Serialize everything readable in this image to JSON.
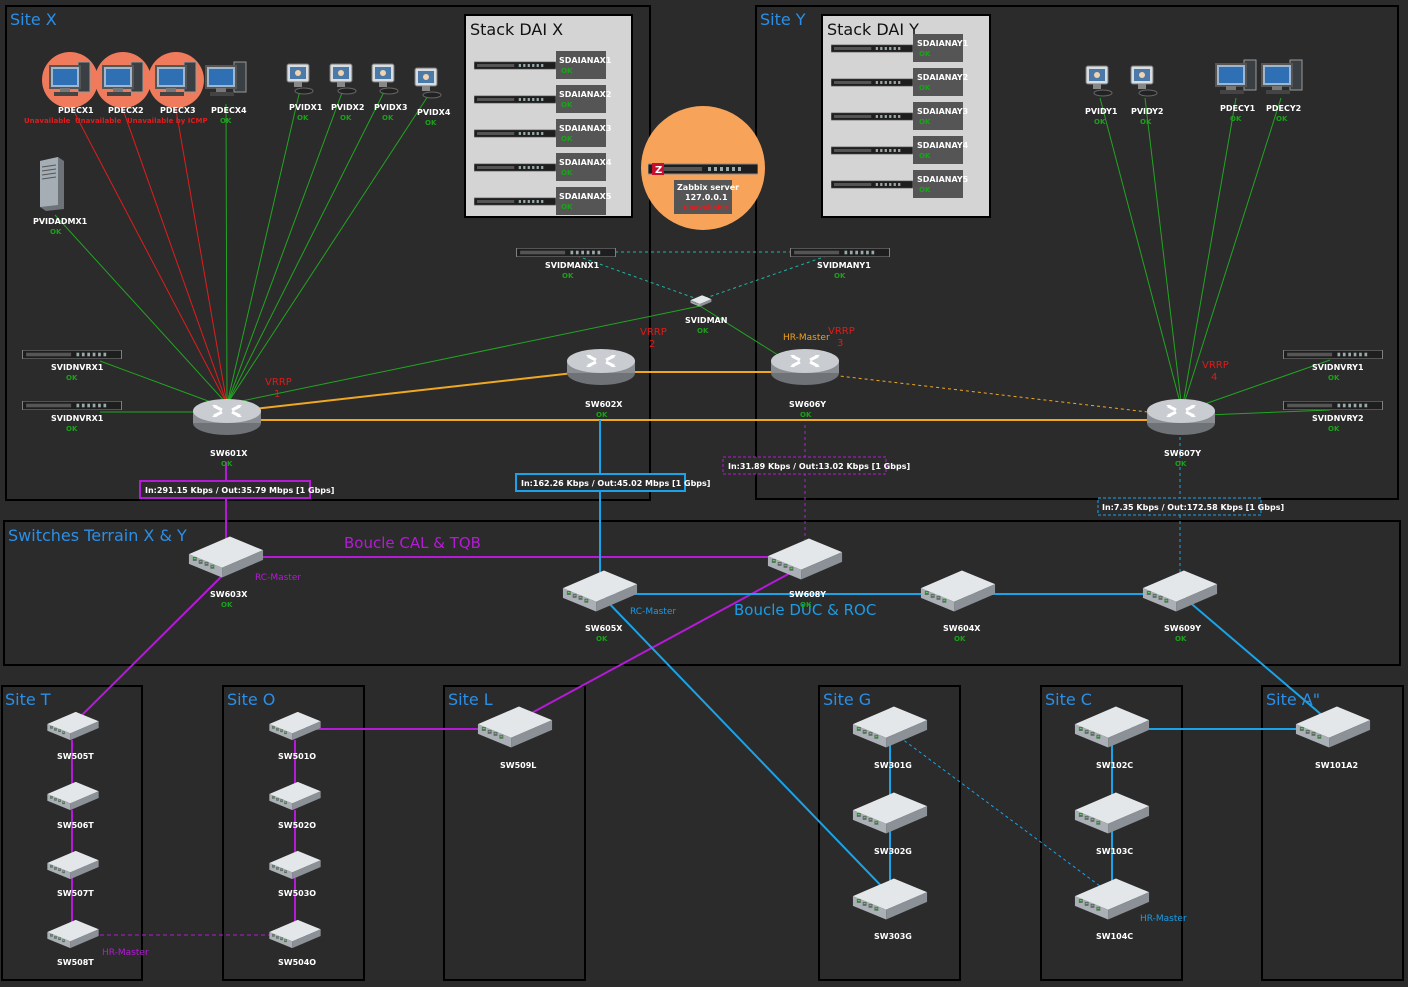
{
  "zones": {
    "site_x": "Site X",
    "site_y": "Site Y",
    "stack_x": "Stack DAI X",
    "stack_y": "Stack DAI Y",
    "terrain": "Switches Terrain X & Y",
    "site_t": "Site T",
    "site_o": "Site O",
    "site_l": "Site L",
    "site_g": "Site G",
    "site_c": "Site C",
    "site_a": "Site A\""
  },
  "loops": {
    "cal_tqb": "Boucle CAL & TQB",
    "duc_roc": "Boucle DUC & ROC"
  },
  "status_ok": "OK",
  "unavailable": "Unavailable",
  "unavailable_icmp": "Unavailable by ICMP",
  "pdecx": [
    "PDECX1",
    "PDECX2",
    "PDECX3",
    "PDECX4"
  ],
  "pvidx": [
    "PVIDX1",
    "PVIDX2",
    "PVIDX3",
    "PVIDX4"
  ],
  "pvidadmx1": "PVIDADMX1",
  "sdaianax": [
    "SDAIANAX1",
    "SDAIANAX2",
    "SDAIANAX3",
    "SDAIANAX4",
    "SDAIANAX5"
  ],
  "sdaianay": [
    "SDAIANAY1",
    "SDAIANAY2",
    "SDAIANAY3",
    "SDAIANAY4",
    "SDAIANAY5"
  ],
  "zabbix": {
    "name": "Zabbix server",
    "ip": "127.0.0.1",
    "status": "Unavailable"
  },
  "svidmanx1": "SVIDMANX1",
  "svidmany1": "SVIDMANY1",
  "svidman": "SVIDMAN",
  "svidnvrx": [
    "SVIDNVRX1",
    "SVIDNVRX1"
  ],
  "svidnvry": [
    "SVIDNVRY1",
    "SVIDNVRY2"
  ],
  "pvidy": [
    "PVIDY1",
    "PVIDY2"
  ],
  "pdecy": [
    "PDECY1",
    "PDECY2"
  ],
  "routers": {
    "sw601x": "SW601X",
    "sw602x": "SW602X",
    "sw606y": "SW606Y",
    "sw607y": "SW607Y"
  },
  "vrrp": {
    "label": "VRRP",
    "n1": "1",
    "n2": "2",
    "n3": "3",
    "n4": "4"
  },
  "hr_master": "HR-Master",
  "rc_master": "RC-Master",
  "bandwidth": {
    "sw601x": "In:291.15 Kbps / Out:35.79 Mbps [1 Gbps]",
    "sw602x": "In:162.26 Kbps / Out:45.02 Mbps [1 Gbps]",
    "sw606y": "In:31.89 Kbps / Out:13.02 Kbps [1 Gbps]",
    "sw607y": "In:7.35 Kbps / Out:172.58 Kbps [1 Gbps]"
  },
  "terrain_switches": {
    "sw603x": "SW603X",
    "sw605x": "SW605X",
    "sw608y": "SW608Y",
    "sw604x": "SW604X",
    "sw609y": "SW609Y"
  },
  "site_t_switches": [
    "SW505T",
    "SW506T",
    "SW507T",
    "SW508T"
  ],
  "site_o_switches": [
    "SW501O",
    "SW502O",
    "SW503O",
    "SW504O"
  ],
  "site_l_switch": "SW509L",
  "site_g_switches": [
    "SW301G",
    "SW302G",
    "SW303G"
  ],
  "site_c_switches": [
    "SW102C",
    "SW103C",
    "SW104C"
  ],
  "site_a_switch": "SW101A2",
  "colors": {
    "background": "#2b2b2b",
    "panel": "#2b2b2b",
    "panel_border": "#000000",
    "zone_title": "#2a8fe8",
    "link_ok": "#22a522",
    "link_down": "#e11d1d",
    "link_core": "#f0a822",
    "link_cal_tqb": "#b51ad6",
    "link_duc_roc": "#1aa3e8",
    "link_mgmt": "#22b3a3",
    "zabbix_circle": "#f8a35a"
  }
}
